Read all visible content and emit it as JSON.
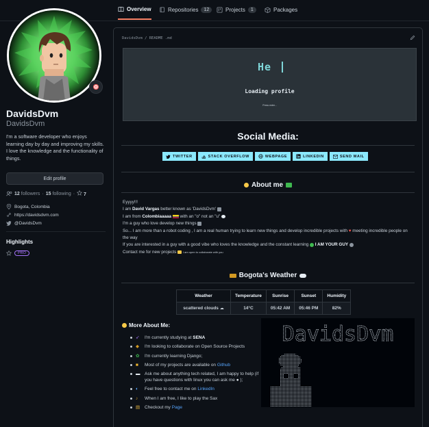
{
  "tabs": [
    {
      "label": "Overview",
      "icon": "book-icon"
    },
    {
      "label": "Repositories",
      "icon": "repo-icon",
      "count": "12"
    },
    {
      "label": "Projects",
      "icon": "project-icon",
      "count": "1"
    },
    {
      "label": "Packages",
      "icon": "package-icon"
    }
  ],
  "profile": {
    "fullname": "DavidsDvm",
    "username": "DavidsDvm",
    "bio": "I'm a software developer who enjoys learning day by day and improving my skills. I love the knowledge and the functionality of things.",
    "edit_label": "Edit profile",
    "followers_count": "12",
    "followers_label": "followers",
    "following_count": "15",
    "following_label": "following",
    "stars_count": "7",
    "location": "Bogota, Colombia",
    "website": "https://davidsdvm.com",
    "twitter": "@DavidsDvm",
    "highlights_title": "Highlights",
    "pro_label": "PRO"
  },
  "readme": {
    "path": "DavidsDvm / README .md",
    "banner_hello": "He",
    "banner_loading": "Loading profile",
    "banner_tiny": "Press enter...",
    "social_title": "Social Media:",
    "badges": [
      "TWITTER",
      "STACK OVERFLOW",
      "WEBPAGE",
      "LINKEDIN",
      "SEND MAIL"
    ],
    "about_title": "About me",
    "about": {
      "l1": "Eyyyy!!!",
      "l2_a": "I am ",
      "l2_b": "David Vargas",
      "l2_c": " better known as 'DavidsDvm'",
      "l3_a": "I am from ",
      "l3_b": "Colombiaaaaa",
      "l3_c": " with an \"o\" not an \"u\"",
      "l4": "I'm a guy who love develop new things",
      "l5": "So... I am more than a robot coding , I am a real human trying to learn new things and develop incredible projects with",
      "l5_b": "meeting incredible people on the way",
      "l6_a": "If you are interested in a guy with a good vibe who loves the knowledge and the constant learning ",
      "l6_b": "I AM YOUR GUY",
      "l7_a": "Contact me for new projects",
      "l7_b": "I am open to collaborate with you"
    },
    "weather_title": "Bogota's Weather",
    "weather_headers": [
      "Weather",
      "Temperature",
      "Sunrise",
      "Sunset",
      "Humidity"
    ],
    "weather_values": [
      "scattered clouds",
      "14°C",
      "05:42 AM",
      "05:46 PM",
      "82%"
    ],
    "more_title": "More About Me:",
    "more": [
      {
        "pre": "I'm currently studying at ",
        "bold": "SENA",
        "post": "",
        "link": ""
      },
      {
        "pre": "I'm looking to collaborate on Open Source Projects",
        "bold": "",
        "post": "",
        "link": ""
      },
      {
        "pre": "I'm currently learning Django;",
        "bold": "",
        "post": "",
        "link": ""
      },
      {
        "pre": "Most of my projects are available on ",
        "bold": "",
        "post": "",
        "link": "Github"
      },
      {
        "pre": "Ask me about anything tech related, I am happy to help (if you have questions with linux you can ask me ",
        "bold": "",
        "post": " );",
        "link": ""
      },
      {
        "pre": "Feel free to contact me on ",
        "bold": "",
        "post": "",
        "link": "LinkedIn"
      },
      {
        "pre": "When I am free, I like to play the Sax",
        "bold": "",
        "post": "",
        "link": ""
      },
      {
        "pre": "Checkout my ",
        "bold": "",
        "post": "",
        "link": "Page"
      }
    ],
    "ascii_title": "DavidsDvm"
  }
}
